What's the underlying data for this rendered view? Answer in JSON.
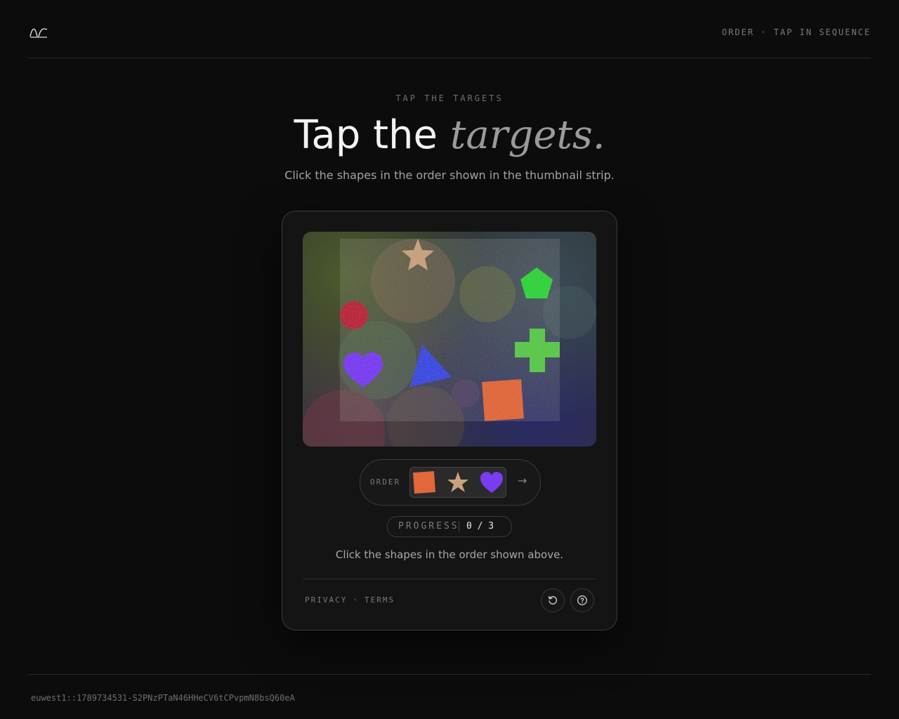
{
  "header": {
    "logo_icon": "wave-logo-icon",
    "mode_label": "ORDER · TAP IN SEQUENCE"
  },
  "hero": {
    "eyebrow": "TAP THE TARGETS",
    "title_plain": "Tap the",
    "title_emphasis": "targets.",
    "subtitle": "Click the shapes in the order shown in the thumbnail strip."
  },
  "challenge": {
    "shapes": [
      {
        "name": "star",
        "color": "#c8a27e"
      },
      {
        "name": "pentagon",
        "color": "#2fd23a"
      },
      {
        "name": "circle",
        "color": "#b8243a"
      },
      {
        "name": "heart",
        "color": "#7a3cf0"
      },
      {
        "name": "triangle",
        "color": "#3a4ae0"
      },
      {
        "name": "cross",
        "color": "#5ac84a"
      },
      {
        "name": "square",
        "color": "#e0683a"
      }
    ],
    "order_label": "ORDER",
    "order_sequence": [
      "square",
      "star",
      "heart"
    ],
    "arrow": "→",
    "progress_label": "PROGRESS",
    "progress_value": "0 / 3",
    "progress_done": 0,
    "progress_total": 3,
    "hint": "Click the shapes in the order shown above."
  },
  "card_footer": {
    "privacy": "PRIVACY",
    "separator": "·",
    "terms": "TERMS",
    "reload_icon": "reload-icon",
    "help_icon": "help-icon"
  },
  "footer": {
    "session_id": "euwest1::1789734531-S2PNzPTaN46HHeCV6tCPvpmN8bsQ60eA"
  }
}
